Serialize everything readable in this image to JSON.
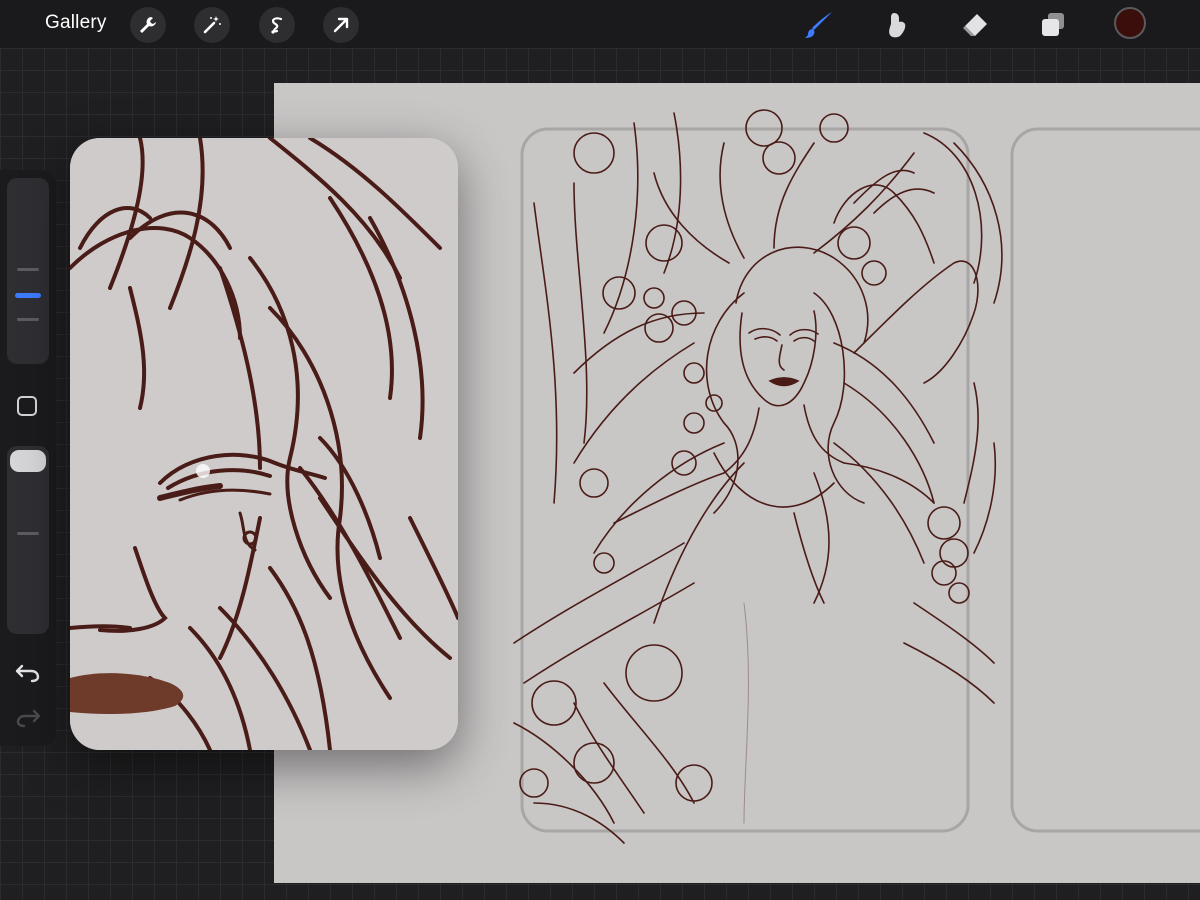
{
  "toolbar": {
    "gallery_label": "Gallery",
    "left_tools": [
      "wrench-icon",
      "magic-wand-icon",
      "selection-icon",
      "transform-arrow-icon"
    ],
    "right_tools": [
      "brush-icon",
      "smudge-icon",
      "eraser-icon",
      "layers-icon"
    ],
    "active_tool": "brush",
    "active_color": "#3a0e0a",
    "accent_color": "#3d7bff"
  },
  "sidebar": {
    "brush_size_slider": "brush-size",
    "opacity_slider": "brush-opacity",
    "modifier_button": "square-modifier",
    "undo_icon": "undo-icon",
    "redo_icon": "redo-icon"
  },
  "canvas": {
    "background_color": "#c9c6c6",
    "sketch_color": "#4a1c17",
    "panels": [
      "left-comic-panel",
      "right-comic-panel"
    ]
  },
  "reference_window": {
    "content": "zoomed-sketch-reference"
  }
}
